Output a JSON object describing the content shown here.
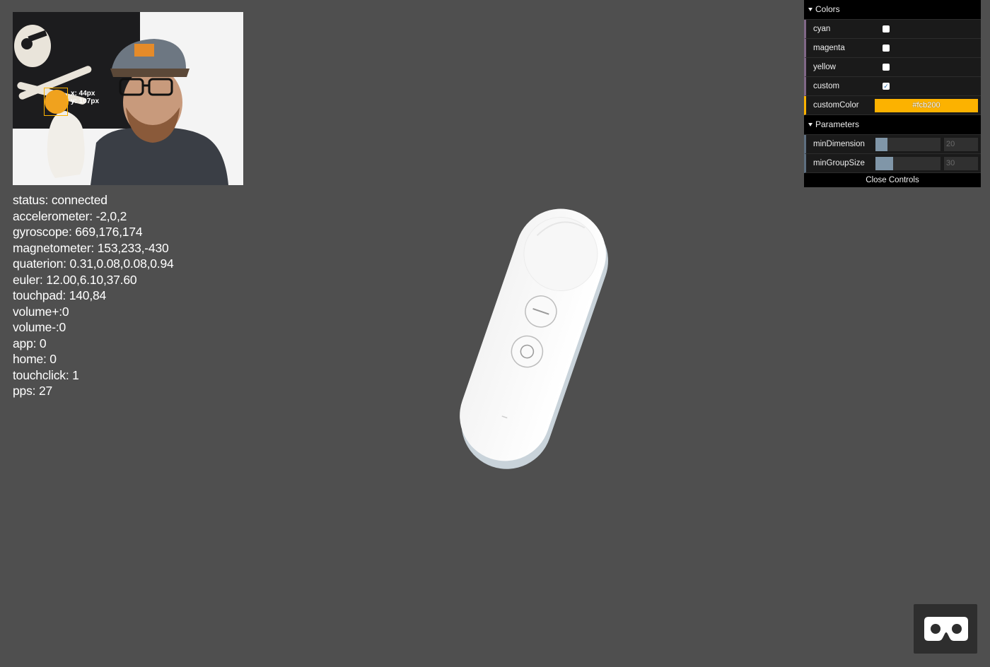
{
  "webcam": {
    "tracker_x": "x: 44px",
    "tracker_y": "y: 107px",
    "tracker_color": "#fcb200"
  },
  "status_lines": [
    "status: connected",
    "accelerometer: -2,0,2",
    "gyroscope: 669,176,174",
    "magnetometer: 153,233,-430",
    "quaterion: 0.31,0.08,0.08,0.94",
    "euler: 12.00,6.10,37.60",
    "touchpad: 140,84",
    "volume+:0",
    "volume-:0",
    "app: 0",
    "home: 0",
    "touchclick: 1",
    "pps: 27"
  ],
  "gui": {
    "colors_folder": "Colors",
    "cyan": {
      "label": "cyan",
      "checked": false
    },
    "magenta": {
      "label": "magenta",
      "checked": false
    },
    "yellow": {
      "label": "yellow",
      "checked": false
    },
    "custom": {
      "label": "custom",
      "checked": true,
      "mark": "✓"
    },
    "custom_color": {
      "label": "customColor",
      "value": "#fcb200"
    },
    "parameters_folder": "Parameters",
    "min_dimension": {
      "label": "minDimension",
      "value": "20",
      "fraction": 0.18
    },
    "min_group_size": {
      "label": "minGroupSize",
      "value": "30",
      "fraction": 0.27
    },
    "close_label": "Close Controls"
  },
  "colors": {
    "background": "#4f4f4f",
    "accent": "#fcb200",
    "gui_background": "#1a1a1a"
  },
  "icons": {
    "vr": "cardboard-vr-icon"
  }
}
